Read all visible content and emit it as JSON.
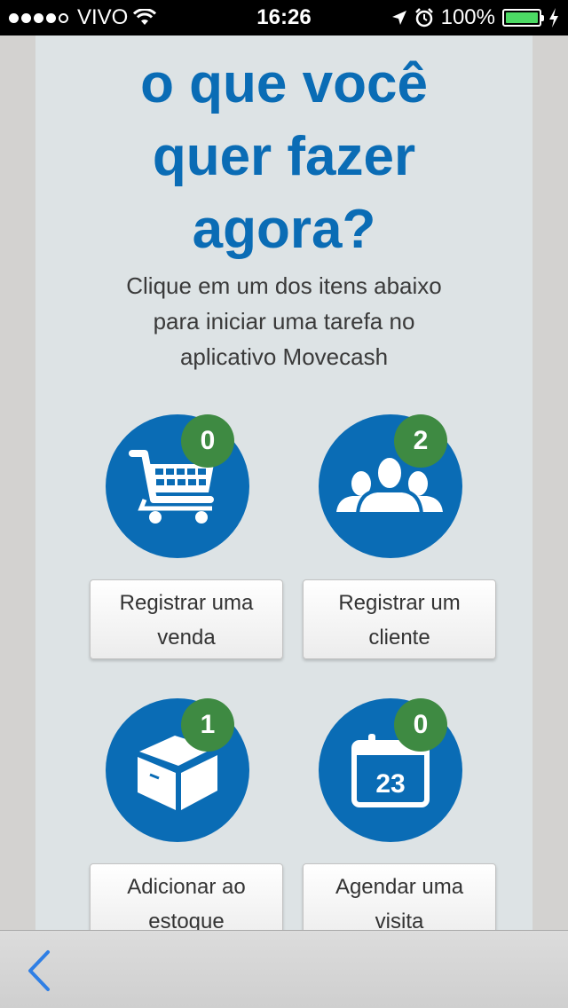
{
  "status_bar": {
    "carrier": "VIVO",
    "time": "16:26",
    "battery": "100%",
    "battery_level": 1.0
  },
  "headline": {
    "line1": "o que você",
    "line2": "quer fazer",
    "line3": "agora?"
  },
  "subtitle": {
    "line1": "Clique em um dos itens abaixo",
    "line2": "para iniciar uma tarefa no",
    "line3": "aplicativo Movecash"
  },
  "actions": [
    {
      "icon": "shopping-cart-icon",
      "badge": "0",
      "label_line1": "Registrar uma",
      "label_line2": "venda"
    },
    {
      "icon": "users-group-icon",
      "badge": "2",
      "label_line1": "Registrar um",
      "label_line2": "cliente"
    },
    {
      "icon": "box-icon",
      "badge": "1",
      "label_line1": "Adicionar ao",
      "label_line2": "estoque"
    },
    {
      "icon": "calendar-icon",
      "badge": "0",
      "label_line1": "Agendar uma",
      "label_line2": "visita",
      "calendar_day": "23"
    }
  ],
  "colors": {
    "primary_blue": "#0a6cb5",
    "badge_green": "#3e8a42",
    "panel_bg": "#dde3e5"
  }
}
